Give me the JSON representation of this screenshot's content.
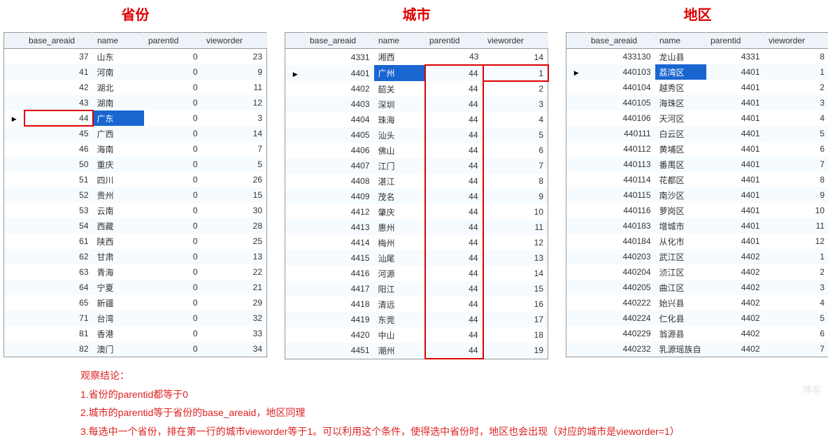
{
  "titles": {
    "province": "省份",
    "city": "城市",
    "district": "地区"
  },
  "headers": {
    "base_areaid": "base_areaid",
    "name": "name",
    "parentid": "parentid",
    "vieworder": "vieworder"
  },
  "province": {
    "selected_id": 44,
    "rows": [
      {
        "id": 37,
        "name": "山东",
        "pid": 0,
        "ord": 23
      },
      {
        "id": 41,
        "name": "河南",
        "pid": 0,
        "ord": 9
      },
      {
        "id": 42,
        "name": "湖北",
        "pid": 0,
        "ord": 11
      },
      {
        "id": 43,
        "name": "湖南",
        "pid": 0,
        "ord": 12
      },
      {
        "id": 44,
        "name": "广东",
        "pid": 0,
        "ord": 3
      },
      {
        "id": 45,
        "name": "广西",
        "pid": 0,
        "ord": 14
      },
      {
        "id": 46,
        "name": "海南",
        "pid": 0,
        "ord": 7
      },
      {
        "id": 50,
        "name": "重庆",
        "pid": 0,
        "ord": 5
      },
      {
        "id": 51,
        "name": "四川",
        "pid": 0,
        "ord": 26
      },
      {
        "id": 52,
        "name": "贵州",
        "pid": 0,
        "ord": 15
      },
      {
        "id": 53,
        "name": "云南",
        "pid": 0,
        "ord": 30
      },
      {
        "id": 54,
        "name": "西藏",
        "pid": 0,
        "ord": 28
      },
      {
        "id": 61,
        "name": "陕西",
        "pid": 0,
        "ord": 25
      },
      {
        "id": 62,
        "name": "甘肃",
        "pid": 0,
        "ord": 13
      },
      {
        "id": 63,
        "name": "青海",
        "pid": 0,
        "ord": 22
      },
      {
        "id": 64,
        "name": "宁夏",
        "pid": 0,
        "ord": 21
      },
      {
        "id": 65,
        "name": "新疆",
        "pid": 0,
        "ord": 29
      },
      {
        "id": 71,
        "name": "台湾",
        "pid": 0,
        "ord": 32
      },
      {
        "id": 81,
        "name": "香港",
        "pid": 0,
        "ord": 33
      },
      {
        "id": 82,
        "name": "澳门",
        "pid": 0,
        "ord": 34
      }
    ]
  },
  "city": {
    "selected_id": 4401,
    "rows": [
      {
        "id": 4331,
        "name": "湘西",
        "pid": 43,
        "ord": 14
      },
      {
        "id": 4401,
        "name": "广州",
        "pid": 44,
        "ord": 1
      },
      {
        "id": 4402,
        "name": "韶关",
        "pid": 44,
        "ord": 2
      },
      {
        "id": 4403,
        "name": "深圳",
        "pid": 44,
        "ord": 3
      },
      {
        "id": 4404,
        "name": "珠海",
        "pid": 44,
        "ord": 4
      },
      {
        "id": 4405,
        "name": "汕头",
        "pid": 44,
        "ord": 5
      },
      {
        "id": 4406,
        "name": "佛山",
        "pid": 44,
        "ord": 6
      },
      {
        "id": 4407,
        "name": "江门",
        "pid": 44,
        "ord": 7
      },
      {
        "id": 4408,
        "name": "湛江",
        "pid": 44,
        "ord": 8
      },
      {
        "id": 4409,
        "name": "茂名",
        "pid": 44,
        "ord": 9
      },
      {
        "id": 4412,
        "name": "肇庆",
        "pid": 44,
        "ord": 10
      },
      {
        "id": 4413,
        "name": "惠州",
        "pid": 44,
        "ord": 11
      },
      {
        "id": 4414,
        "name": "梅州",
        "pid": 44,
        "ord": 12
      },
      {
        "id": 4415,
        "name": "汕尾",
        "pid": 44,
        "ord": 13
      },
      {
        "id": 4416,
        "name": "河源",
        "pid": 44,
        "ord": 14
      },
      {
        "id": 4417,
        "name": "阳江",
        "pid": 44,
        "ord": 15
      },
      {
        "id": 4418,
        "name": "清远",
        "pid": 44,
        "ord": 16
      },
      {
        "id": 4419,
        "name": "东莞",
        "pid": 44,
        "ord": 17
      },
      {
        "id": 4420,
        "name": "中山",
        "pid": 44,
        "ord": 18
      },
      {
        "id": 4451,
        "name": "潮州",
        "pid": 44,
        "ord": 19
      }
    ]
  },
  "district": {
    "selected_id": 440103,
    "rows": [
      {
        "id": 433130,
        "name": "龙山县",
        "pid": 4331,
        "ord": 8
      },
      {
        "id": 440103,
        "name": "荔湾区",
        "pid": 4401,
        "ord": 1
      },
      {
        "id": 440104,
        "name": "越秀区",
        "pid": 4401,
        "ord": 2
      },
      {
        "id": 440105,
        "name": "海珠区",
        "pid": 4401,
        "ord": 3
      },
      {
        "id": 440106,
        "name": "天河区",
        "pid": 4401,
        "ord": 4
      },
      {
        "id": 440111,
        "name": "白云区",
        "pid": 4401,
        "ord": 5
      },
      {
        "id": 440112,
        "name": "黄埔区",
        "pid": 4401,
        "ord": 6
      },
      {
        "id": 440113,
        "name": "番禺区",
        "pid": 4401,
        "ord": 7
      },
      {
        "id": 440114,
        "name": "花都区",
        "pid": 4401,
        "ord": 8
      },
      {
        "id": 440115,
        "name": "南沙区",
        "pid": 4401,
        "ord": 9
      },
      {
        "id": 440116,
        "name": "萝岗区",
        "pid": 4401,
        "ord": 10
      },
      {
        "id": 440183,
        "name": "增城市",
        "pid": 4401,
        "ord": 11
      },
      {
        "id": 440184,
        "name": "从化市",
        "pid": 4401,
        "ord": 12
      },
      {
        "id": 440203,
        "name": "武江区",
        "pid": 4402,
        "ord": 1
      },
      {
        "id": 440204,
        "name": "浈江区",
        "pid": 4402,
        "ord": 2
      },
      {
        "id": 440205,
        "name": "曲江区",
        "pid": 4402,
        "ord": 3
      },
      {
        "id": 440222,
        "name": "始兴县",
        "pid": 4402,
        "ord": 4
      },
      {
        "id": 440224,
        "name": "仁化县",
        "pid": 4402,
        "ord": 5
      },
      {
        "id": 440229,
        "name": "翁源县",
        "pid": 4402,
        "ord": 6
      },
      {
        "id": 440232,
        "name": "乳源瑶族自",
        "pid": 4402,
        "ord": 7
      }
    ]
  },
  "notes": {
    "t": "观察结论：",
    "l1": "1.省份的parentid都等于0",
    "l2": "2.城市的parentid等于省份的base_areaid，地区同理",
    "l3": "3.每选中一个省份，排在第一行的城市vieworder等于1。可以利用这个条件，使得选中省份时，地区也会出现（对应的城市是vieworder=1）"
  },
  "col_widths": {
    "mark": 16,
    "id": 85,
    "name": 60,
    "pid": 70,
    "ord": 80
  }
}
